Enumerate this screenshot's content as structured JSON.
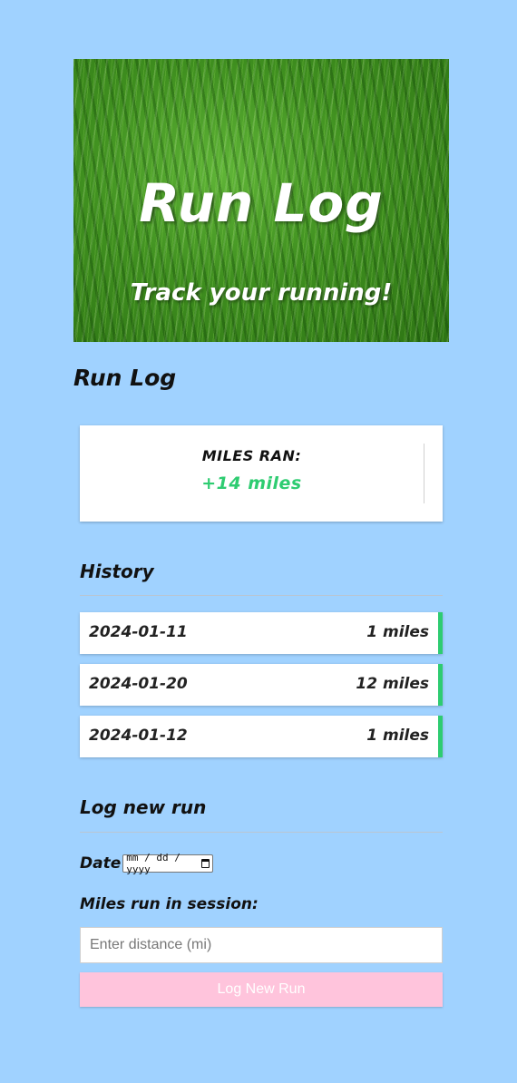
{
  "hero": {
    "title": "Run Log",
    "subtitle": "Track your running!"
  },
  "section_title": "Run Log",
  "summary": {
    "label": "MILES RAN:",
    "value": "+14 miles",
    "value_color": "#2ecc71"
  },
  "history": {
    "title": "History",
    "items": [
      {
        "date": "2024-01-11",
        "miles": "1 miles"
      },
      {
        "date": "2024-01-20",
        "miles": "12 miles"
      },
      {
        "date": "2024-01-12",
        "miles": "1 miles"
      }
    ]
  },
  "form": {
    "title": "Log new run",
    "date_label": "Date",
    "date_placeholder": "mm / dd / yyyy",
    "miles_label": "Miles run in session:",
    "distance_placeholder": "Enter distance (mi)",
    "submit_label": "Log New Run"
  },
  "colors": {
    "background": "#a0d2ff",
    "accent": "#2ecc71",
    "button": "#ffc4dc"
  }
}
